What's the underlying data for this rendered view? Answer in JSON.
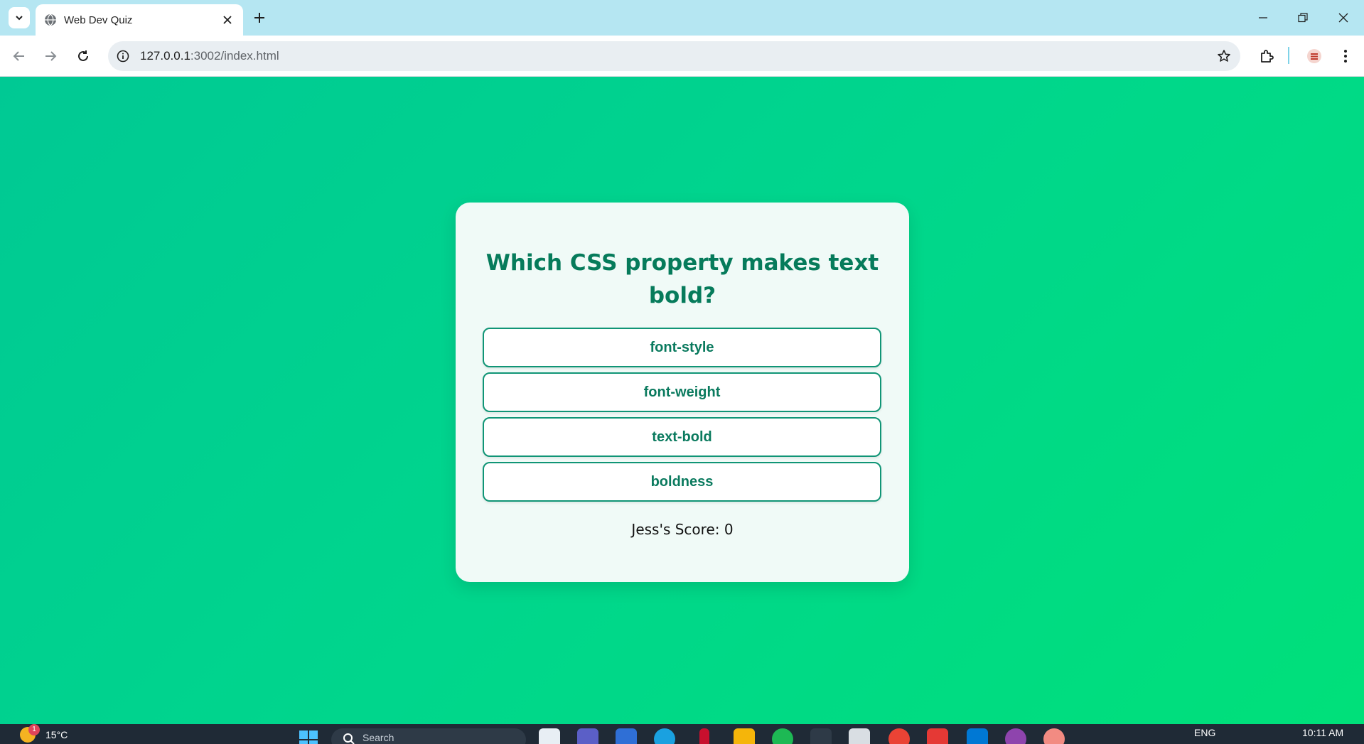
{
  "browser": {
    "tab": {
      "title": "Web Dev Quiz"
    },
    "url": {
      "host": "127.0.0.1",
      "rest": ":3002/index.html"
    }
  },
  "quiz": {
    "question": "Which CSS property makes text bold?",
    "answers": [
      "font-style",
      "font-weight",
      "text-bold",
      "boldness"
    ],
    "score_text": "Jess's Score: 0"
  },
  "taskbar": {
    "weather": {
      "badge": "1",
      "temperature": "15°C"
    },
    "search_placeholder": "Search",
    "language": "ENG",
    "time": "10:11 AM"
  },
  "colors": {
    "page_bg": "#00d48f",
    "card_bg": "#f0faf7",
    "accent": "#067b5b",
    "button_border": "#109576",
    "tabstrip": "#b5e6f2"
  },
  "icons": [
    "tab-list-icon",
    "globe-icon",
    "close-icon",
    "plus-icon",
    "minimize-icon",
    "restore-icon",
    "back-icon",
    "forward-icon",
    "reload-icon",
    "info-icon",
    "star-icon",
    "extensions-icon",
    "profile-icon",
    "kebab-menu-icon"
  ]
}
